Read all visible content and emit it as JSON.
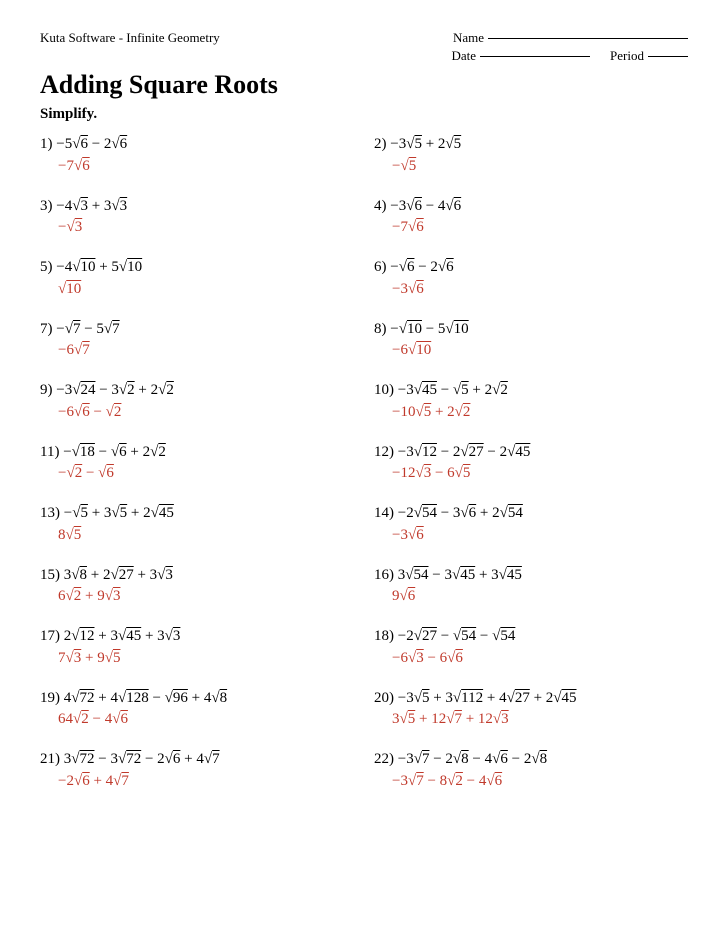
{
  "header": {
    "software": "Kuta Software - Infinite Geometry",
    "name_label": "Name",
    "date_label": "Date",
    "period_label": "Period"
  },
  "title": "Adding Square Roots",
  "instruction": "Simplify.",
  "problems": [
    {
      "num": "1)",
      "question_html": "&minus;5&radic;<span style='text-decoration:overline'>6</span> &minus; 2&radic;<span style='text-decoration:overline'>6</span>",
      "answer_html": "&minus;7&radic;<span style='text-decoration:overline'>6</span>"
    },
    {
      "num": "2)",
      "question_html": "&minus;3&radic;<span style='text-decoration:overline'>5</span> + 2&radic;<span style='text-decoration:overline'>5</span>",
      "answer_html": "&minus;&radic;<span style='text-decoration:overline'>5</span>"
    },
    {
      "num": "3)",
      "question_html": "&minus;4&radic;<span style='text-decoration:overline'>3</span> + 3&radic;<span style='text-decoration:overline'>3</span>",
      "answer_html": "&minus;&radic;<span style='text-decoration:overline'>3</span>"
    },
    {
      "num": "4)",
      "question_html": "&minus;3&radic;<span style='text-decoration:overline'>6</span> &minus; 4&radic;<span style='text-decoration:overline'>6</span>",
      "answer_html": "&minus;7&radic;<span style='text-decoration:overline'>6</span>"
    },
    {
      "num": "5)",
      "question_html": "&minus;4&radic;<span style='text-decoration:overline'>10</span> + 5&radic;<span style='text-decoration:overline'>10</span>",
      "answer_html": "&radic;<span style='text-decoration:overline'>10</span>"
    },
    {
      "num": "6)",
      "question_html": "&minus;&radic;<span style='text-decoration:overline'>6</span> &minus; 2&radic;<span style='text-decoration:overline'>6</span>",
      "answer_html": "&minus;3&radic;<span style='text-decoration:overline'>6</span>"
    },
    {
      "num": "7)",
      "question_html": "&minus;&radic;<span style='text-decoration:overline'>7</span> &minus; 5&radic;<span style='text-decoration:overline'>7</span>",
      "answer_html": "&minus;6&radic;<span style='text-decoration:overline'>7</span>"
    },
    {
      "num": "8)",
      "question_html": "&minus;&radic;<span style='text-decoration:overline'>10</span> &minus; 5&radic;<span style='text-decoration:overline'>10</span>",
      "answer_html": "&minus;6&radic;<span style='text-decoration:overline'>10</span>"
    },
    {
      "num": "9)",
      "question_html": "&minus;3&radic;<span style='text-decoration:overline'>24</span> &minus; 3&radic;<span style='text-decoration:overline'>2</span> + 2&radic;<span style='text-decoration:overline'>2</span>",
      "answer_html": "&minus;6&radic;<span style='text-decoration:overline'>6</span> &minus; &radic;<span style='text-decoration:overline'>2</span>"
    },
    {
      "num": "10)",
      "question_html": "&minus;3&radic;<span style='text-decoration:overline'>45</span> &minus; &radic;<span style='text-decoration:overline'>5</span> + 2&radic;<span style='text-decoration:overline'>2</span>",
      "answer_html": "&minus;10&radic;<span style='text-decoration:overline'>5</span> + 2&radic;<span style='text-decoration:overline'>2</span>"
    },
    {
      "num": "11)",
      "question_html": "&minus;&radic;<span style='text-decoration:overline'>18</span> &minus; &radic;<span style='text-decoration:overline'>6</span> + 2&radic;<span style='text-decoration:overline'>2</span>",
      "answer_html": "&minus;&radic;<span style='text-decoration:overline'>2</span> &minus; &radic;<span style='text-decoration:overline'>6</span>"
    },
    {
      "num": "12)",
      "question_html": "&minus;3&radic;<span style='text-decoration:overline'>12</span> &minus; 2&radic;<span style='text-decoration:overline'>27</span> &minus; 2&radic;<span style='text-decoration:overline'>45</span>",
      "answer_html": "&minus;12&radic;<span style='text-decoration:overline'>3</span> &minus; 6&radic;<span style='text-decoration:overline'>5</span>"
    },
    {
      "num": "13)",
      "question_html": "&minus;&radic;<span style='text-decoration:overline'>5</span> + 3&radic;<span style='text-decoration:overline'>5</span> + 2&radic;<span style='text-decoration:overline'>45</span>",
      "answer_html": "8&radic;<span style='text-decoration:overline'>5</span>"
    },
    {
      "num": "14)",
      "question_html": "&minus;2&radic;<span style='text-decoration:overline'>54</span> &minus; 3&radic;<span style='text-decoration:overline'>6</span> + 2&radic;<span style='text-decoration:overline'>54</span>",
      "answer_html": "&minus;3&radic;<span style='text-decoration:overline'>6</span>"
    },
    {
      "num": "15)",
      "question_html": "3&radic;<span style='text-decoration:overline'>8</span> + 2&radic;<span style='text-decoration:overline'>27</span> + 3&radic;<span style='text-decoration:overline'>3</span>",
      "answer_html": "6&radic;<span style='text-decoration:overline'>2</span> + 9&radic;<span style='text-decoration:overline'>3</span>"
    },
    {
      "num": "16)",
      "question_html": "3&radic;<span style='text-decoration:overline'>54</span> &minus; 3&radic;<span style='text-decoration:overline'>45</span> + 3&radic;<span style='text-decoration:overline'>45</span>",
      "answer_html": "9&radic;<span style='text-decoration:overline'>6</span>"
    },
    {
      "num": "17)",
      "question_html": "2&radic;<span style='text-decoration:overline'>12</span> + 3&radic;<span style='text-decoration:overline'>45</span> + 3&radic;<span style='text-decoration:overline'>3</span>",
      "answer_html": "7&radic;<span style='text-decoration:overline'>3</span> + 9&radic;<span style='text-decoration:overline'>5</span>"
    },
    {
      "num": "18)",
      "question_html": "&minus;2&radic;<span style='text-decoration:overline'>27</span> &minus; &radic;<span style='text-decoration:overline'>54</span> &minus; &radic;<span style='text-decoration:overline'>54</span>",
      "answer_html": "&minus;6&radic;<span style='text-decoration:overline'>3</span> &minus; 6&radic;<span style='text-decoration:overline'>6</span>"
    },
    {
      "num": "19)",
      "question_html": "4&radic;<span style='text-decoration:overline'>72</span> + 4&radic;<span style='text-decoration:overline'>128</span> &minus; &radic;<span style='text-decoration:overline'>96</span> + 4&radic;<span style='text-decoration:overline'>8</span>",
      "answer_html": "64&radic;<span style='text-decoration:overline'>2</span> &minus; 4&radic;<span style='text-decoration:overline'>6</span>"
    },
    {
      "num": "20)",
      "question_html": "&minus;3&radic;<span style='text-decoration:overline'>5</span> + 3&radic;<span style='text-decoration:overline'>112</span> + 4&radic;<span style='text-decoration:overline'>27</span> + 2&radic;<span style='text-decoration:overline'>45</span>",
      "answer_html": "3&radic;<span style='text-decoration:overline'>5</span> + 12&radic;<span style='text-decoration:overline'>7</span> + 12&radic;<span style='text-decoration:overline'>3</span>"
    },
    {
      "num": "21)",
      "question_html": "3&radic;<span style='text-decoration:overline'>72</span> &minus; 3&radic;<span style='text-decoration:overline'>72</span> &minus; 2&radic;<span style='text-decoration:overline'>6</span> + 4&radic;<span style='text-decoration:overline'>7</span>",
      "answer_html": "&minus;2&radic;<span style='text-decoration:overline'>6</span> + 4&radic;<span style='text-decoration:overline'>7</span>"
    },
    {
      "num": "22)",
      "question_html": "&minus;3&radic;<span style='text-decoration:overline'>7</span> &minus; 2&radic;<span style='text-decoration:overline'>8</span> &minus; 4&radic;<span style='text-decoration:overline'>6</span> &minus; 2&radic;<span style='text-decoration:overline'>8</span>",
      "answer_html": "&minus;3&radic;<span style='text-decoration:overline'>7</span> &minus; 8&radic;<span style='text-decoration:overline'>2</span> &minus; 4&radic;<span style='text-decoration:overline'>6</span>"
    }
  ]
}
